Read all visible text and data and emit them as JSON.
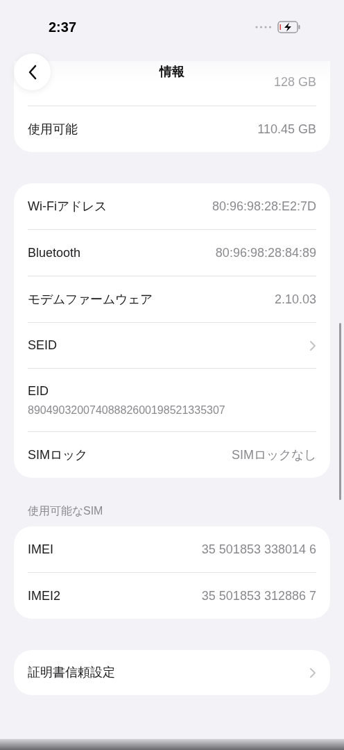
{
  "status_bar": {
    "time": "2:37",
    "battery_charging": true
  },
  "nav": {
    "title": "情報"
  },
  "groups": [
    {
      "rows": [
        {
          "kind": "faded",
          "value": "128 GB"
        },
        {
          "kind": "value",
          "label": "使用可能",
          "value": "110.45 GB"
        }
      ]
    },
    {
      "rows": [
        {
          "kind": "value",
          "label": "Wi-Fiアドレス",
          "value": "80:96:98:28:E2:7D"
        },
        {
          "kind": "value",
          "label": "Bluetooth",
          "value": "80:96:98:28:84:89"
        },
        {
          "kind": "value",
          "label": "モデムファームウェア",
          "value": "2.10.03"
        },
        {
          "kind": "chevron",
          "label": "SEID"
        },
        {
          "kind": "stacked",
          "label": "EID",
          "value": "89049032007408882600198521335307"
        },
        {
          "kind": "value",
          "label": "SIMロック",
          "value": "SIMロックなし"
        }
      ]
    },
    {
      "header": "使用可能なSIM",
      "rows": [
        {
          "kind": "value",
          "label": "IMEI",
          "value": "35 501853 338014 6"
        },
        {
          "kind": "value",
          "label": "IMEI2",
          "value": "35 501853 312886 7"
        }
      ]
    },
    {
      "rows": [
        {
          "kind": "chevron",
          "label": "証明書信頼設定"
        }
      ]
    }
  ]
}
